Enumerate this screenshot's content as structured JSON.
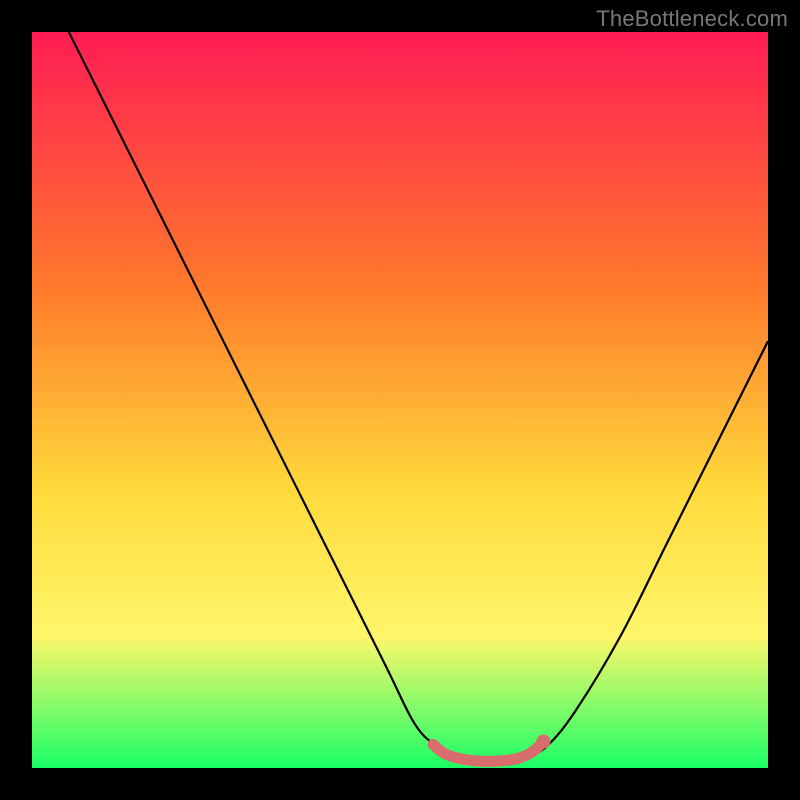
{
  "watermark": "TheBottleneck.com",
  "colors": {
    "bg": "#000000",
    "gradient_top": "#ff1c54",
    "gradient_mid1": "#ff7a2b",
    "gradient_mid2": "#ffd93b",
    "gradient_mid3": "#fff66a",
    "gradient_bottom": "#1aff66",
    "curve": "#000000",
    "highlight": "#d96d6d"
  },
  "chart_data": {
    "type": "line",
    "title": "",
    "xlabel": "",
    "ylabel": "",
    "xlim": [
      0,
      100
    ],
    "ylim": [
      0,
      100
    ],
    "series": [
      {
        "name": "bottleneck-curve",
        "x": [
          0,
          8,
          16,
          24,
          32,
          40,
          48,
          52,
          55,
          58,
          61,
          64,
          67,
          70,
          74,
          80,
          86,
          92,
          100
        ],
        "y": [
          110,
          94,
          78,
          62,
          46,
          30,
          14,
          6,
          3,
          1.5,
          1,
          1,
          1.5,
          3,
          8,
          18,
          30,
          42,
          58
        ]
      },
      {
        "name": "optimal-range-highlight",
        "x": [
          54.5,
          56,
          58,
          60,
          62,
          64,
          66,
          68,
          69.5
        ],
        "y": [
          3.2,
          2.0,
          1.3,
          1.0,
          0.9,
          1.0,
          1.3,
          2.2,
          3.6
        ]
      }
    ],
    "gradient_stops": [
      {
        "offset": 0.0,
        "color": "#ff1c54"
      },
      {
        "offset": 0.35,
        "color": "#ff7a2b"
      },
      {
        "offset": 0.62,
        "color": "#ffd93b"
      },
      {
        "offset": 0.82,
        "color": "#fff66a"
      },
      {
        "offset": 1.0,
        "color": "#1aff66"
      }
    ]
  }
}
